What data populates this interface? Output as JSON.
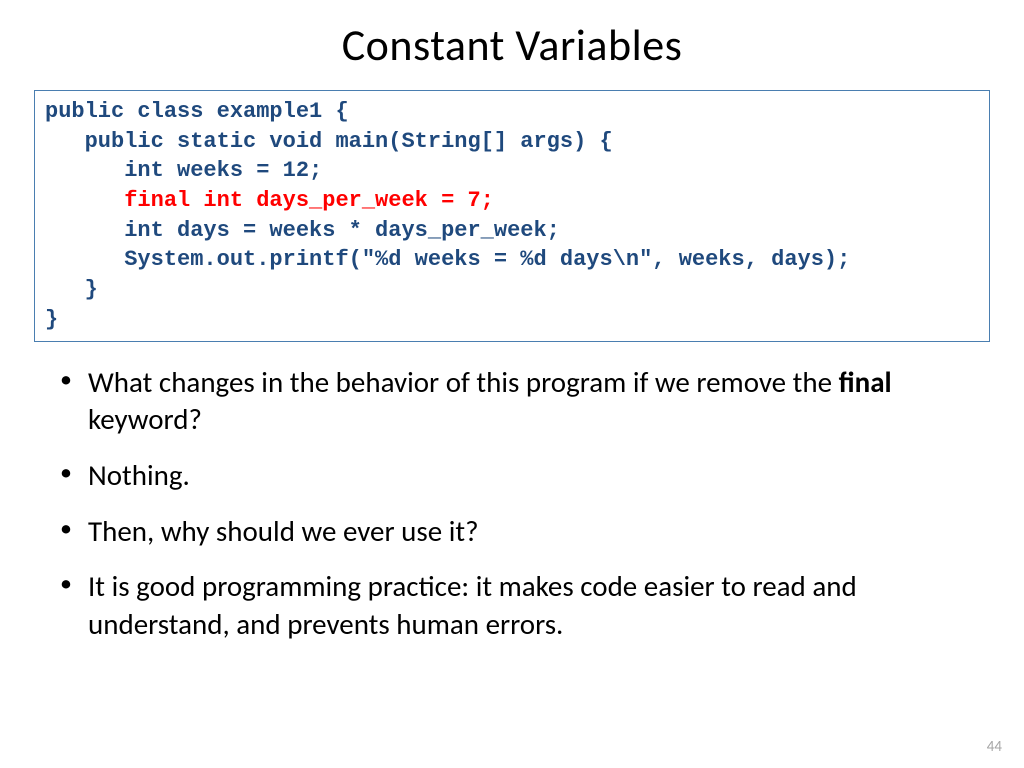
{
  "title": "Constant Variables",
  "code": {
    "l1": "public class example1 {",
    "l2": "   public static void main(String[] args) {",
    "l3": "      int weeks = 12;",
    "l4": "      final int days_per_week = 7;",
    "l5": "      int days = weeks * days_per_week;",
    "l6": "      System.out.printf(\"%d weeks = %d days\\n\", weeks, days);",
    "l7": "   }",
    "l8": "}"
  },
  "bullets": {
    "b1_pre": "What changes in the behavior of this program if we remove the ",
    "b1_bold": "final",
    "b1_post": " keyword?",
    "b2": "Nothing.",
    "b3": "Then, why should we ever use it?",
    "b4": "It is good programming practice: it makes code easier to read and understand, and prevents human errors."
  },
  "page_number": "44"
}
